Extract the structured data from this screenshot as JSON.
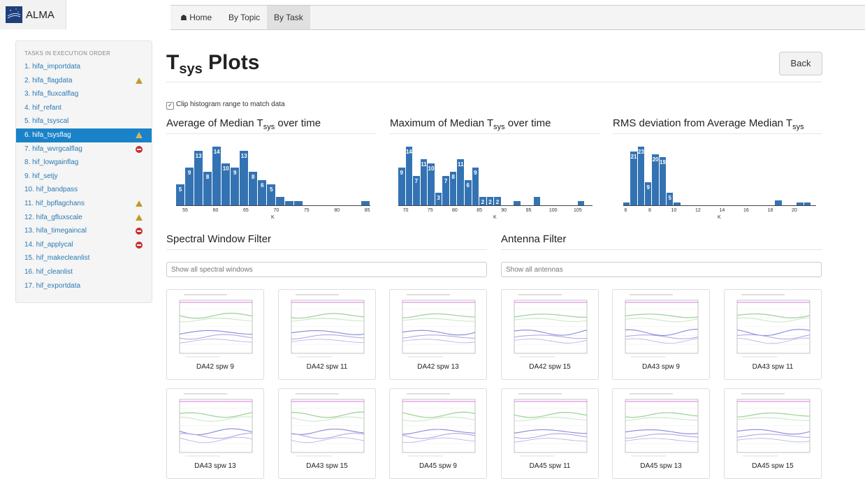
{
  "brand": {
    "name": "ALMA"
  },
  "nav": {
    "items": [
      "Home",
      "By Topic",
      "By Task"
    ],
    "active": "By Task"
  },
  "sidebar": {
    "heading": "TASKS IN EXECUTION ORDER",
    "items": [
      {
        "label": "1. hifa_importdata",
        "status": ""
      },
      {
        "label": "2. hifa_flagdata",
        "status": "warning"
      },
      {
        "label": "3. hifa_fluxcalflag",
        "status": ""
      },
      {
        "label": "4. hif_refant",
        "status": ""
      },
      {
        "label": "5. hifa_tsyscal",
        "status": ""
      },
      {
        "label": "6. hifa_tsysflag",
        "status": "warning",
        "active": true
      },
      {
        "label": "7. hifa_wvrgcalflag",
        "status": "error"
      },
      {
        "label": "8. hif_lowgainflag",
        "status": ""
      },
      {
        "label": "9. hif_setjy",
        "status": ""
      },
      {
        "label": "10. hif_bandpass",
        "status": ""
      },
      {
        "label": "11. hif_bpflagchans",
        "status": "warning"
      },
      {
        "label": "12. hifa_gfluxscale",
        "status": "warning"
      },
      {
        "label": "13. hifa_timegaincal",
        "status": "error"
      },
      {
        "label": "14. hif_applycal",
        "status": "error"
      },
      {
        "label": "15. hif_makecleanlist",
        "status": ""
      },
      {
        "label": "16. hif_cleanlist",
        "status": ""
      },
      {
        "label": "17. hif_exportdata",
        "status": ""
      }
    ]
  },
  "page": {
    "title_main": "T",
    "title_sub": "sys",
    "title_rest": " Plots",
    "back_label": "Back",
    "clip_label": "Clip histogram range to match data",
    "clip_checked": true,
    "spw_filter_title": "Spectral Window Filter",
    "ant_filter_title": "Antenna Filter",
    "spw_placeholder": "Show all spectral windows",
    "ant_placeholder": "Show all antennas"
  },
  "histograms": {
    "h1": {
      "title_pre": "Average of Median T",
      "title_sub": "sys",
      "title_post": " over time"
    },
    "h2": {
      "title_pre": "Maximum of Median T",
      "title_sub": "sys",
      "title_post": " over time"
    },
    "h3": {
      "title_pre": "RMS deviation from Average Median T",
      "title_sub": "sys",
      "title_post": ""
    }
  },
  "chart_data": [
    {
      "type": "bar",
      "title": "Average of Median Tsys over time",
      "xlabel": "K",
      "x_ticks": [
        55,
        60,
        65,
        70,
        75,
        80,
        85
      ],
      "xlim": [
        53.5,
        85.5
      ],
      "bin_width": 1.5,
      "bins": [
        {
          "x": 53.5,
          "count": 5
        },
        {
          "x": 55,
          "count": 9
        },
        {
          "x": 56.5,
          "count": 13
        },
        {
          "x": 58,
          "count": 8
        },
        {
          "x": 59.5,
          "count": 14
        },
        {
          "x": 61,
          "count": 10
        },
        {
          "x": 62.5,
          "count": 9
        },
        {
          "x": 64,
          "count": 13
        },
        {
          "x": 65.5,
          "count": 8
        },
        {
          "x": 67,
          "count": 6
        },
        {
          "x": 68.5,
          "count": 5
        },
        {
          "x": 70,
          "count": 2
        },
        {
          "x": 71.5,
          "count": 1
        },
        {
          "x": 73,
          "count": 1
        },
        {
          "x": 84,
          "count": 1
        }
      ],
      "labels": [
        "5",
        "9",
        "13",
        "8",
        "14",
        "10",
        "9",
        "13",
        "8",
        "6",
        "5",
        "",
        "",
        "",
        ""
      ]
    },
    {
      "type": "bar",
      "title": "Maximum of Median Tsys over time",
      "xlabel": "K",
      "x_ticks": [
        70,
        75,
        80,
        85,
        90,
        95,
        100,
        105
      ],
      "xlim": [
        68.5,
        108
      ],
      "bin_width": 1.5,
      "bins": [
        {
          "x": 68.5,
          "count": 9
        },
        {
          "x": 70,
          "count": 14
        },
        {
          "x": 71.5,
          "count": 7
        },
        {
          "x": 73,
          "count": 11
        },
        {
          "x": 74.5,
          "count": 10
        },
        {
          "x": 76,
          "count": 3
        },
        {
          "x": 77.5,
          "count": 7
        },
        {
          "x": 79,
          "count": 8
        },
        {
          "x": 80.5,
          "count": 11
        },
        {
          "x": 82,
          "count": 6
        },
        {
          "x": 83.5,
          "count": 9
        },
        {
          "x": 85,
          "count": 2
        },
        {
          "x": 86.5,
          "count": 2
        },
        {
          "x": 88,
          "count": 2
        },
        {
          "x": 92,
          "count": 1
        },
        {
          "x": 96,
          "count": 2
        },
        {
          "x": 105,
          "count": 1
        }
      ],
      "labels": [
        "9",
        "14",
        "7",
        "11",
        "10",
        "3",
        "7",
        "8",
        "11",
        "6",
        "9",
        "2",
        "2",
        "2",
        "",
        "",
        ""
      ]
    },
    {
      "type": "bar",
      "title": "RMS deviation from Average Median Tsys",
      "xlabel": "K",
      "x_ticks": [
        6,
        8,
        10,
        12,
        14,
        16,
        18,
        20
      ],
      "xlim": [
        5.8,
        21.8
      ],
      "bin_width": 0.6,
      "bins": [
        {
          "x": 5.8,
          "count": 1
        },
        {
          "x": 6.4,
          "count": 21
        },
        {
          "x": 7.0,
          "count": 23
        },
        {
          "x": 7.6,
          "count": 9
        },
        {
          "x": 8.2,
          "count": 20
        },
        {
          "x": 8.8,
          "count": 19
        },
        {
          "x": 9.4,
          "count": 5
        },
        {
          "x": 10.0,
          "count": 1
        },
        {
          "x": 18.4,
          "count": 2
        },
        {
          "x": 20.2,
          "count": 1
        },
        {
          "x": 20.8,
          "count": 1
        }
      ],
      "labels": [
        "",
        "21",
        "23",
        "9",
        "20",
        "19",
        "5",
        "",
        "",
        "",
        ""
      ]
    }
  ],
  "thumbnails": [
    "DA42 spw 9",
    "DA42 spw 11",
    "DA42 spw 13",
    "DA42 spw 15",
    "DA43 spw 9",
    "DA43 spw 11",
    "DA43 spw 13",
    "DA43 spw 15",
    "DA45 spw 9",
    "DA45 spw 11",
    "DA45 spw 13",
    "DA45 spw 15"
  ],
  "colors": {
    "accent": "#1a82c8",
    "bar": "#3473b3",
    "warning": "#c19a2e",
    "error": "#c9302c"
  }
}
